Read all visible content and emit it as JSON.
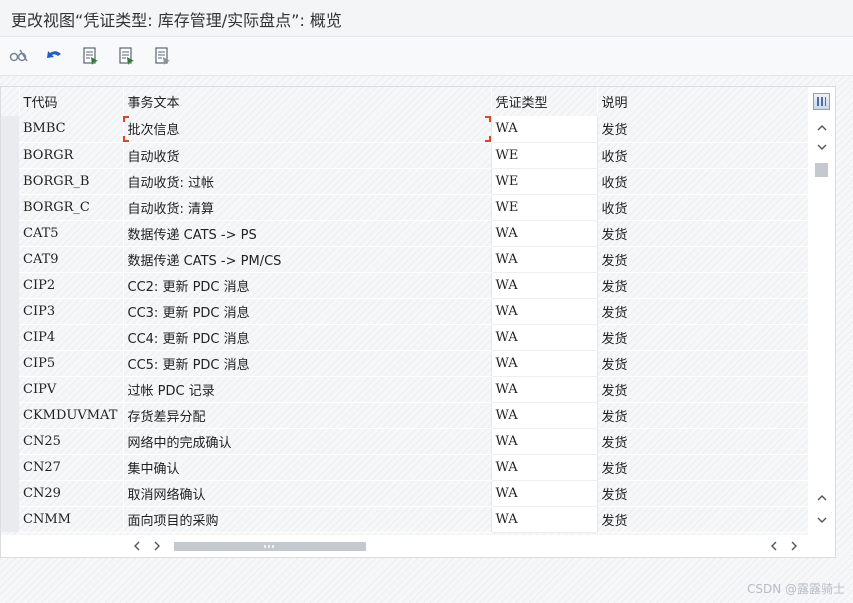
{
  "window": {
    "title": "更改视图“凭证类型: 库存管理/实际盘点”: 概览"
  },
  "toolbar": {
    "buttons": [
      {
        "icon": "display-change-icon"
      },
      {
        "icon": "undo-icon"
      },
      {
        "icon": "new-entries-icon"
      },
      {
        "icon": "copy-as-icon"
      },
      {
        "icon": "delete-icon"
      }
    ]
  },
  "table": {
    "columns": [
      "T代码",
      "事务文本",
      "凭证类型",
      "说明"
    ],
    "rows": [
      {
        "tcode": "BMBC",
        "text": "批次信息",
        "doc_type": "WA",
        "desc": "发货"
      },
      {
        "tcode": "BORGR",
        "text": "自动收货",
        "doc_type": "WE",
        "desc": "收货"
      },
      {
        "tcode": "BORGR_B",
        "text": "自动收货: 过帐",
        "doc_type": "WE",
        "desc": "收货"
      },
      {
        "tcode": "BORGR_C",
        "text": "自动收货: 清算",
        "doc_type": "WE",
        "desc": "收货"
      },
      {
        "tcode": "CAT5",
        "text": "数据传递 CATS -> PS",
        "doc_type": "WA",
        "desc": "发货"
      },
      {
        "tcode": "CAT9",
        "text": "数据传递 CATS -> PM/CS",
        "doc_type": "WA",
        "desc": "发货"
      },
      {
        "tcode": "CIP2",
        "text": "CC2:  更新 PDC 消息",
        "doc_type": "WA",
        "desc": "发货"
      },
      {
        "tcode": "CIP3",
        "text": "CC3:  更新 PDC 消息",
        "doc_type": "WA",
        "desc": "发货"
      },
      {
        "tcode": "CIP4",
        "text": "CC4:  更新 PDC 消息",
        "doc_type": "WA",
        "desc": "发货"
      },
      {
        "tcode": "CIP5",
        "text": "CC5: 更新 PDC 消息",
        "doc_type": "WA",
        "desc": "发货"
      },
      {
        "tcode": "CIPV",
        "text": "过帐 PDC 记录",
        "doc_type": "WA",
        "desc": "发货"
      },
      {
        "tcode": "CKMDUVMAT",
        "text": "存货差异分配",
        "doc_type": "WA",
        "desc": "发货"
      },
      {
        "tcode": "CN25",
        "text": "网络中的完成确认",
        "doc_type": "WA",
        "desc": "发货"
      },
      {
        "tcode": "CN27",
        "text": "集中确认",
        "doc_type": "WA",
        "desc": "发货"
      },
      {
        "tcode": "CN29",
        "text": "取消网络确认",
        "doc_type": "WA",
        "desc": "发货"
      },
      {
        "tcode": "CNMM",
        "text": "面向项目的采购",
        "doc_type": "WA",
        "desc": "发货"
      }
    ]
  },
  "watermark": "CSDN @露露骑士"
}
